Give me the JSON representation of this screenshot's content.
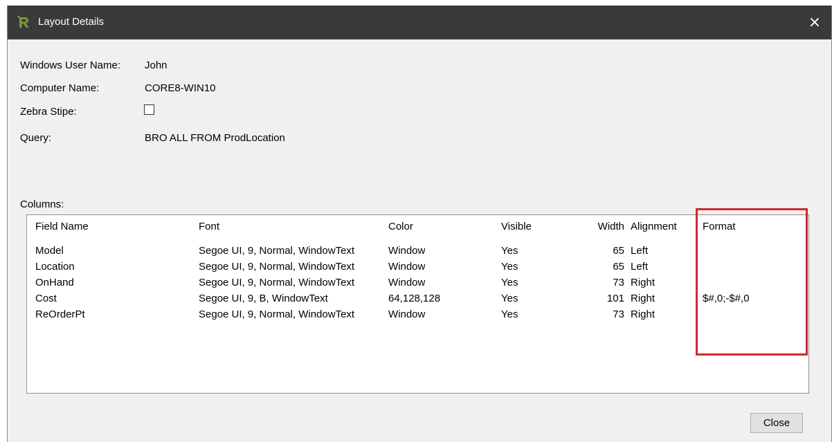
{
  "window": {
    "title": "Layout Details",
    "close_glyph": "×"
  },
  "fields": {
    "user_label": "Windows User Name:",
    "user_value": "John",
    "computer_label": "Computer Name:",
    "computer_value": "CORE8-WIN10",
    "zebra_label": "Zebra Stipe:",
    "zebra_checked": false,
    "query_label": "Query:",
    "query_value": "BRO ALL FROM ProdLocation"
  },
  "columns_label": "Columns:",
  "table": {
    "headers": [
      "Field Name",
      "Font",
      "Color",
      "Visible",
      "Width",
      "Alignment",
      "Format"
    ],
    "rows": [
      [
        "Model",
        "Segoe UI, 9, Normal, WindowText",
        "Window",
        "Yes",
        "65",
        "Left",
        ""
      ],
      [
        "Location",
        "Segoe UI, 9, Normal, WindowText",
        "Window",
        "Yes",
        "65",
        "Left",
        ""
      ],
      [
        "OnHand",
        "Segoe UI, 9, Normal, WindowText",
        "Window",
        "Yes",
        "73",
        "Right",
        ""
      ],
      [
        "Cost",
        "Segoe UI, 9, B, WindowText",
        "64,128,128",
        "Yes",
        "101",
        "Right",
        "$#,0;-$#,0"
      ],
      [
        "ReOrderPt",
        "Segoe UI, 9, Normal, WindowText",
        "Window",
        "Yes",
        "73",
        "Right",
        ""
      ]
    ]
  },
  "buttons": {
    "close_label": "Close"
  },
  "colors": {
    "titlebar": "#3a3a3a",
    "highlight": "#d1282f",
    "icon": "#5b7a2a"
  },
  "icons": {
    "app": "app-logo-icon",
    "close": "close-icon"
  }
}
